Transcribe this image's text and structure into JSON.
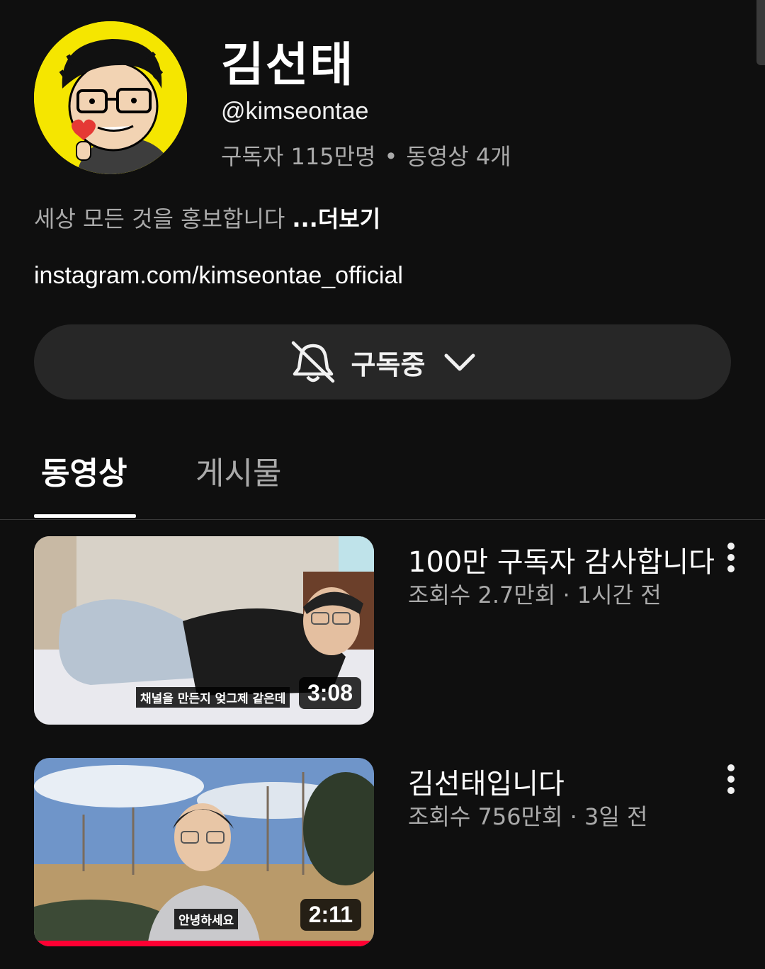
{
  "channel": {
    "name": "김선태",
    "handle": "@kimseontae",
    "subscribers": "구독자 115만명",
    "separator": "•",
    "video_count": "동영상 4개",
    "description": "세상 모든 것을 홍보합니다",
    "more_label": "...더보기",
    "link": "instagram.com/kimseontae_official",
    "avatar_icon": "cartoon-portrait"
  },
  "subscribe_button": {
    "label": "구독중",
    "bell_icon": "bell-off-icon",
    "chevron_icon": "chevron-down-icon"
  },
  "tabs": [
    {
      "label": "동영상",
      "active": true
    },
    {
      "label": "게시물",
      "active": false
    }
  ],
  "videos": [
    {
      "title": "100만 구독자 감사합니다",
      "views": "조회수 2.7만회",
      "separator": "·",
      "age": "1시간 전",
      "duration": "3:08",
      "caption": "채널을 만든지 엊그제 같은데",
      "watched_fraction": 0
    },
    {
      "title": "김선태입니다",
      "views": "조회수 756만회",
      "separator": "·",
      "age": "3일 전",
      "duration": "2:11",
      "caption": "안녕하세요",
      "watched_fraction": 1.0
    }
  ],
  "colors": {
    "background": "#0f0f0f",
    "button": "#272727",
    "progress": "#ff0033",
    "secondary_text": "#aaaaaa"
  }
}
